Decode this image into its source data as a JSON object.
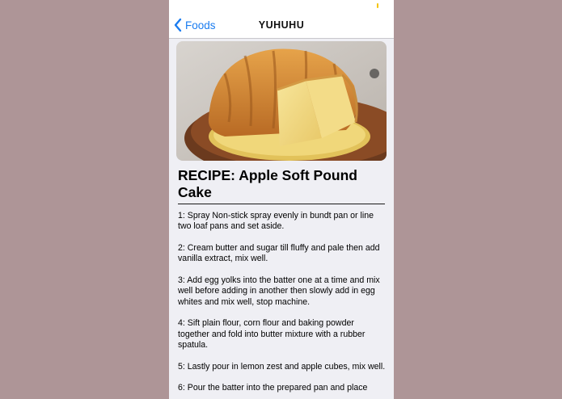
{
  "nav": {
    "back_label": "Foods",
    "title": "YUHUHU"
  },
  "hero_image": {
    "description_icon": "pound-cake-photo"
  },
  "recipe": {
    "title": "RECIPE: Apple Soft Pound Cake",
    "steps": [
      "1: Spray Non-stick spray evenly in bundt pan or line two loaf pans and set aside.",
      "2: Cream butter and sugar till fluffy and pale then add vanilla extract, mix well.",
      "3: Add egg yolks into the batter one at a time and mix well before adding in another then slowly add in egg whites and mix well, stop machine.",
      "4: Sift plain flour, corn flour and baking powder together and fold into butter mixture with a rubber spatula.",
      "5: Lastly pour in lemon zest and apple cubes, mix well.",
      "6: Pour the batter into the prepared pan and place"
    ]
  },
  "colors": {
    "accent": "#1a7cf0",
    "page_background": "#ae9597",
    "screen_background": "#efeff4",
    "battery_indicator": "#f5c400"
  }
}
